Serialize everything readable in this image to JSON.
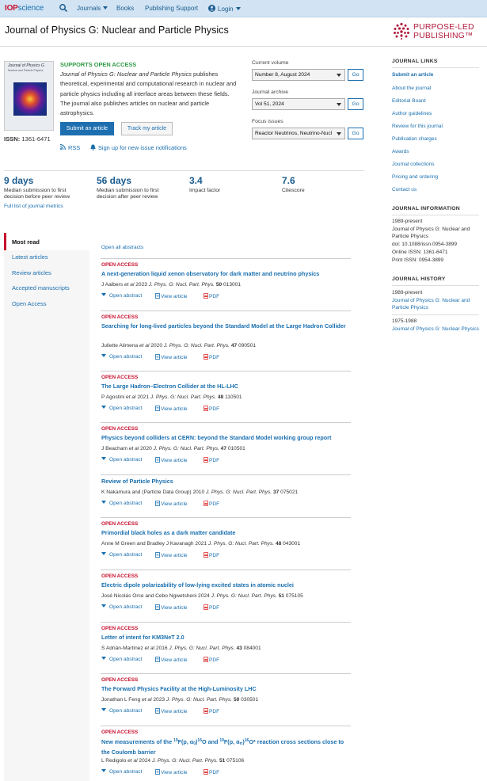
{
  "topbar": {
    "logo_a": "IOP",
    "logo_b": "science",
    "nav": [
      "Journals",
      "Books",
      "Publishing Support",
      "Login"
    ]
  },
  "journal": {
    "title": "Journal of Physics G: Nuclear and Particle Physics",
    "cover_title": "Journal of Physics G",
    "cover_subtitle": "Nuclear and Particle Physics",
    "issn_label": "ISSN:",
    "issn": "1361-6471",
    "supports": "SUPPORTS OPEN ACCESS",
    "desc_italic": "Journal of Physics G: Nuclear and Particle Physics",
    "desc_rest": " publishes theoretical, experimental and computational research in nuclear and particle physics including all interface areas between these fields. The journal also publishes articles on nuclear and particle astrophysics.",
    "submit": "Submit an article",
    "track": "Track my article",
    "rss": "RSS",
    "signup": "Sign up for new issue notifications"
  },
  "brand": {
    "line1": "PURPOSE-LED",
    "line2": "PUBLISHING™"
  },
  "finders": [
    {
      "label": "Current volume",
      "value": "Number 8, August 2024",
      "go": "Go"
    },
    {
      "label": "Journal archive",
      "value": "Vol 51, 2024",
      "go": "Go"
    },
    {
      "label": "Focus issues",
      "value": "Reactor Neutrinos, Neutrino-Nucl",
      "go": "Go"
    }
  ],
  "metrics": [
    {
      "value": "9 days",
      "label": "Median submission to first decision before peer review"
    },
    {
      "value": "56 days",
      "label": "Median submission to first decision after peer review"
    },
    {
      "value": "3.4",
      "label": "Impact factor"
    },
    {
      "value": "7.6",
      "label": "Citescore"
    }
  ],
  "full_list": "Full list of journal metrics",
  "tabs": [
    "Most read",
    "Latest articles",
    "Review articles",
    "Accepted manuscripts",
    "Open Access"
  ],
  "open_all": "Open all abstracts",
  "actions": {
    "abstract": "Open abstract",
    "view": "View article",
    "pdf": "PDF"
  },
  "articles": [
    {
      "oa": "OPEN ACCESS",
      "title": "A next-generation liquid xenon observatory for dark matter and neutrino physics",
      "authors": "J Aalbers ",
      "etal": "et al",
      "year": " 2023 ",
      "journal": "J. Phys. G: Nucl. Part. Phys.",
      "vol": "50",
      "num": " 013001"
    },
    {
      "oa": "OPEN ACCESS",
      "title": "Searching for long-lived particles beyond the Standard Model at the Large Hadron Collider",
      "authors": "Juliette Alimena ",
      "etal": "et al",
      "year": " 2020 ",
      "journal": "J. Phys. G: Nucl. Part. Phys.",
      "vol": "47",
      "num": " 090501"
    },
    {
      "oa": "OPEN ACCESS",
      "title": "The Large Hadron–Electron Collider at the HL-LHC",
      "authors": "P Agostini ",
      "etal": "et al",
      "year": " 2021 ",
      "journal": "J. Phys. G: Nucl. Part. Phys.",
      "vol": "48",
      "num": " 110501"
    },
    {
      "oa": "OPEN ACCESS",
      "title": "Physics beyond colliders at CERN: beyond the Standard Model working group report",
      "authors": "J Beacham ",
      "etal": "et al",
      "year": " 2020 ",
      "journal": "J. Phys. G: Nucl. Part. Phys.",
      "vol": "47",
      "num": " 010501"
    },
    {
      "oa": "",
      "title": "Review of Particle Physics",
      "authors": "K Nakamura and (Particle Data Group)",
      "etal": "",
      "year": " 2010 ",
      "journal": "J. Phys. G: Nucl. Part. Phys.",
      "vol": "37",
      "num": " 075021"
    },
    {
      "oa": "OPEN ACCESS",
      "title": "Primordial black holes as a dark matter candidate",
      "authors": "Anne M Green and Bradley J Kavanagh",
      "etal": "",
      "year": " 2021 ",
      "journal": "J. Phys. G: Nucl. Part. Phys.",
      "vol": "48",
      "num": " 043001"
    },
    {
      "oa": "OPEN ACCESS",
      "title": "Electric dipole polarizability of low-lying excited states in atomic nuclei",
      "authors": "José Nicolás Orce and Cebo Ngwetsheni",
      "etal": "",
      "year": " 2024 ",
      "journal": "J. Phys. G: Nucl. Part. Phys.",
      "vol": "51",
      "num": " 075105"
    },
    {
      "oa": "OPEN ACCESS",
      "title": "Letter of intent for KM3NeT 2.0",
      "authors": "S Adrián-Martínez ",
      "etal": "et al",
      "year": " 2016 ",
      "journal": "J. Phys. G: Nucl. Part. Phys.",
      "vol": "43",
      "num": " 084001"
    },
    {
      "oa": "OPEN ACCESS",
      "title": "The Forward Physics Facility at the High-Luminosity LHC",
      "authors": "Jonathan L Feng ",
      "etal": "et al",
      "year": " 2023 ",
      "journal": "J. Phys. G: Nucl. Part. Phys.",
      "vol": "50",
      "num": " 030501"
    },
    {
      "oa": "OPEN ACCESS",
      "title": "",
      "authors": "L Redigolo ",
      "etal": "et al",
      "year": " 2024 ",
      "journal": "J. Phys. G: Nucl. Part. Phys.",
      "vol": "51",
      "num": " 075106"
    }
  ],
  "last_title": {
    "p1": "New measurements of the ",
    "s1": "19",
    "p2": "F(p, α",
    "b1": "0",
    "p3": ")",
    "s2": "16",
    "p4": "O and ",
    "s3": "19",
    "p5": "F(p, α",
    "b2": "π",
    "p6": ")",
    "s4": "16",
    "p7": "O* reaction cross sections close to the Coulomb barrier"
  },
  "sidebar": {
    "links_head": "JOURNAL LINKS",
    "links": [
      "Submit an article",
      "About the journal",
      "Editorial Board",
      "Author guidelines",
      "Review for this journal",
      "Publication charges",
      "Awards",
      "Journal collections",
      "Pricing and ordering",
      "Contact us"
    ],
    "info_head": "JOURNAL INFORMATION",
    "info": [
      "1989-present",
      "Journal of Physics G: Nuclear and Particle Physics",
      "doi: 10.1088/issn.0954-3899",
      "Online ISSN: 1361-6471",
      "Print ISSN: 0954-3899"
    ],
    "history_head": "JOURNAL HISTORY",
    "h1_years": "1989-present",
    "h1_link": "Journal of Physics G: Nuclear and Particle Physics",
    "h2_years": "1975-1988",
    "h2_link": "Journal of Physics G: Nuclear Physics"
  }
}
